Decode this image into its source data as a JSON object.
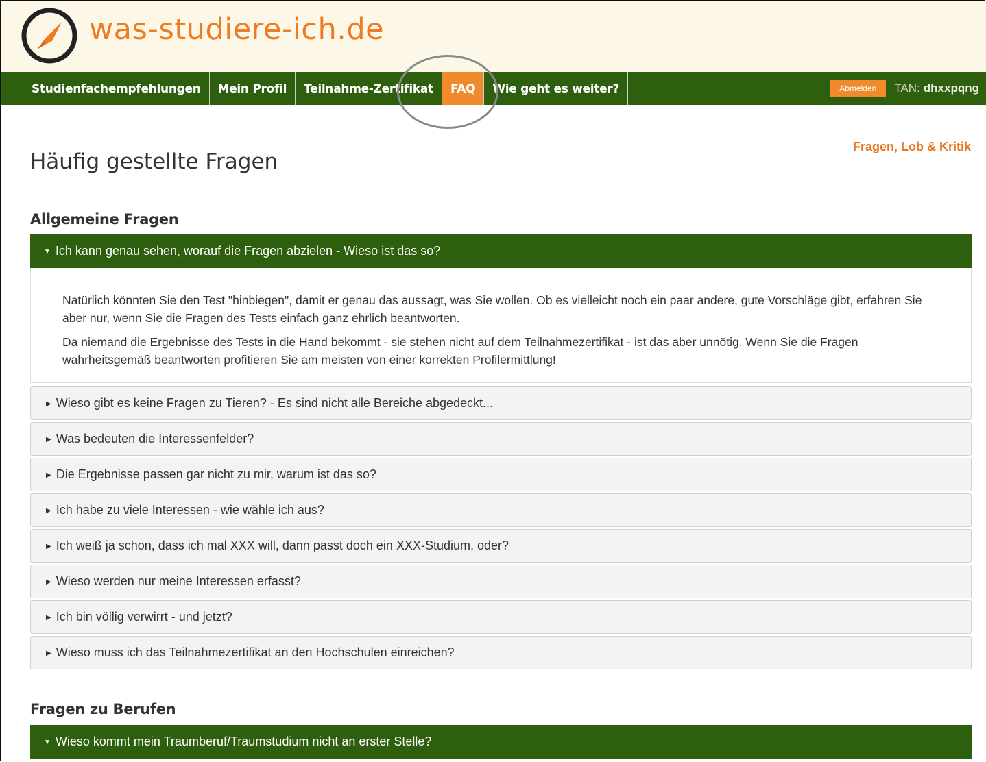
{
  "site": {
    "title": "was-studiere-ich.de"
  },
  "nav": {
    "items": [
      {
        "label": "Studienfachempfehlungen"
      },
      {
        "label": "Mein Profil"
      },
      {
        "label": "Teilnahme-Zertifikat"
      },
      {
        "label": "FAQ",
        "active": true
      },
      {
        "label": "Wie geht es weiter?"
      }
    ],
    "logout_label": "Abmelden",
    "tan_label": "TAN:",
    "tan_value": "dhxxpqng"
  },
  "feedback_link": "Fragen, Lob & Kritik",
  "page_title": "Häufig gestellte Fragen",
  "sections": [
    {
      "title": "Allgemeine Fragen",
      "open_question": "Ich kann genau sehen, worauf die Fragen abzielen - Wieso ist das so?",
      "open_answer": [
        "Natürlich könnten Sie den Test \"hinbiegen\", damit er genau das aussagt, was Sie wollen. Ob es vielleicht noch ein paar andere, gute Vorschläge gibt, erfahren Sie aber nur, wenn Sie die Fragen des Tests einfach ganz ehrlich beantworten.",
        "Da niemand die Ergebnisse des Tests in die Hand bekommt - sie stehen nicht auf dem Teilnahmezertifikat - ist das aber unnötig. Wenn Sie die Fragen wahrheitsgemäß beantworten profitieren Sie am meisten von einer korrekten Profilermittlung!"
      ],
      "questions": [
        "Wieso gibt es keine Fragen zu Tieren? - Es sind nicht alle Bereiche abgedeckt...",
        "Was bedeuten die Interessenfelder?",
        "Die Ergebnisse passen gar nicht zu mir, warum ist das so?",
        "Ich habe zu viele Interessen - wie wähle ich aus?",
        "Ich weiß ja schon, dass ich mal XXX will, dann passt doch ein XXX-Studium, oder?",
        "Wieso werden nur meine Interessen erfasst?",
        "Ich bin völlig verwirrt - und jetzt?",
        "Wieso muss ich das Teilnahmezertifikat an den Hochschulen einreichen?"
      ]
    },
    {
      "title": "Fragen zu Berufen",
      "open_question": "Wieso kommt mein Traumberuf/Traumstudium nicht an erster Stelle?"
    }
  ],
  "colors": {
    "brand_orange": "#ee7c22",
    "nav_green": "#2e5f0e",
    "active_orange": "#f08a2a"
  },
  "icons": {
    "logo": "compass-icon",
    "open": "caret-down-icon",
    "closed": "caret-right-icon"
  }
}
